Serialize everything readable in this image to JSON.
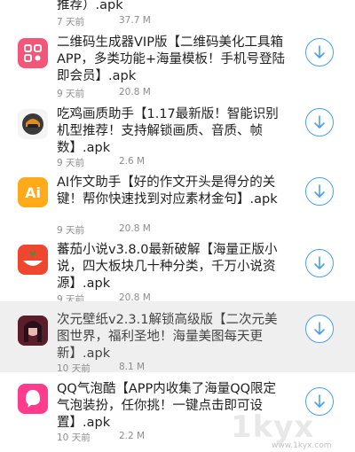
{
  "top_item": {
    "title": "推荐）.apk",
    "time": "7 天前",
    "size": "37.7 M"
  },
  "items": [
    {
      "title": "二维码生成器VIP版【二维码美化工具箱APP，多类功能+海量模板！手机号登陆即会员】.apk",
      "time": "9 天前",
      "size": "20.8 M",
      "icon": "qr-code-app-icon",
      "color": "#f2577a"
    },
    {
      "title": "吃鸡画质助手【1.17最新版！智能识别机型推荐！支持解锁画质、音质、帧数】.apk",
      "time": "9 天前",
      "size": "2.6 M",
      "icon": "game-helmet-icon",
      "color": "#3a3a3a"
    },
    {
      "title": "AI作文助手【好的作文开头是得分的关键！帮你快速找到对应素材金句】.apk",
      "time": "9 天前",
      "size": "20.8 M",
      "icon": "ai-app-icon",
      "color": "#ffaa19"
    },
    {
      "title": "蕃茄小说v3.8.0最新破解【海量正版小说，四大板块几十种分类，千万小说资源】.apk",
      "time": "9 天前",
      "size": "20.8 M",
      "icon": "tomato-novel-icon",
      "color": "#f0452e"
    },
    {
      "title": "次元壁纸v2.3.1解锁高级版【二次元美图世界，福利圣地！海量美图每天更新】.apk",
      "time": "10 天前",
      "size": "8.1 M",
      "icon": "anime-wallpaper-icon",
      "color": "#a23a3a"
    },
    {
      "title": "QQ气泡酷【APP内收集了海量QQ限定气泡装扮，任你挑！一键点击即可设置】.apk",
      "time": "10 天前",
      "size": "2.2 M",
      "icon": "qq-bubble-icon",
      "color": "#ff3c8c"
    }
  ],
  "watermark": {
    "text": "1kyx",
    "url": "www.1kyx.com"
  }
}
